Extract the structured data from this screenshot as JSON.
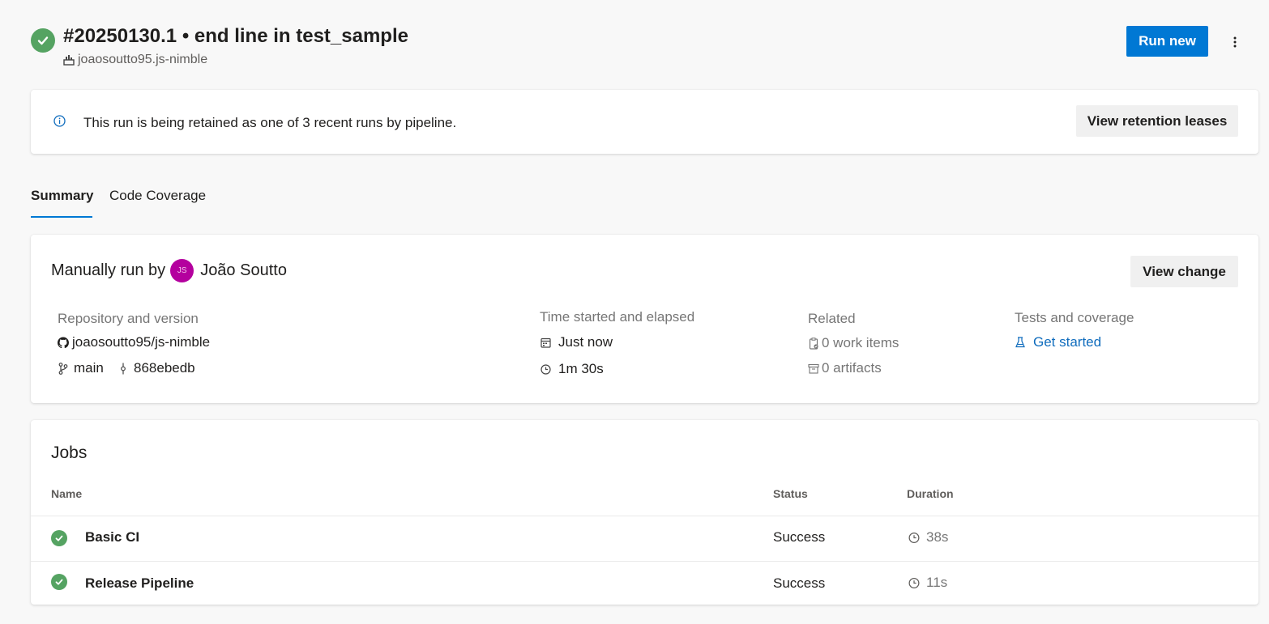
{
  "header": {
    "title": "#20250130.1 • end line in test_sample",
    "repo": "joaosoutto95.js-nimble",
    "run_new_label": "Run new"
  },
  "banner": {
    "text": "This run is being retained as one of 3 recent runs by pipeline.",
    "button_label": "View retention leases"
  },
  "tabs": [
    {
      "label": "Summary",
      "active": true
    },
    {
      "label": "Code Coverage",
      "active": false
    }
  ],
  "summary": {
    "manual_prefix": "Manually run by",
    "avatar_initials": "JS",
    "user_name": "João Soutto",
    "view_change_label": "View change",
    "repository": {
      "label": "Repository and version",
      "repo": "joaosoutto95/js-nimble",
      "branch": "main",
      "commit": "868ebedb"
    },
    "time": {
      "label": "Time started and elapsed",
      "started": "Just now",
      "elapsed": "1m 30s"
    },
    "related": {
      "label": "Related",
      "work_items": "0 work items",
      "artifacts": "0 artifacts"
    },
    "tests": {
      "label": "Tests and coverage",
      "link": "Get started"
    }
  },
  "jobs": {
    "title": "Jobs",
    "columns": {
      "name": "Name",
      "status": "Status",
      "duration": "Duration"
    },
    "rows": [
      {
        "name": "Basic CI",
        "status": "Success",
        "duration": "38s"
      },
      {
        "name": "Release Pipeline",
        "status": "Success",
        "duration": "11s"
      }
    ]
  },
  "colors": {
    "accent": "#0078d4",
    "success": "#55a362",
    "avatar": "#b4009e"
  }
}
